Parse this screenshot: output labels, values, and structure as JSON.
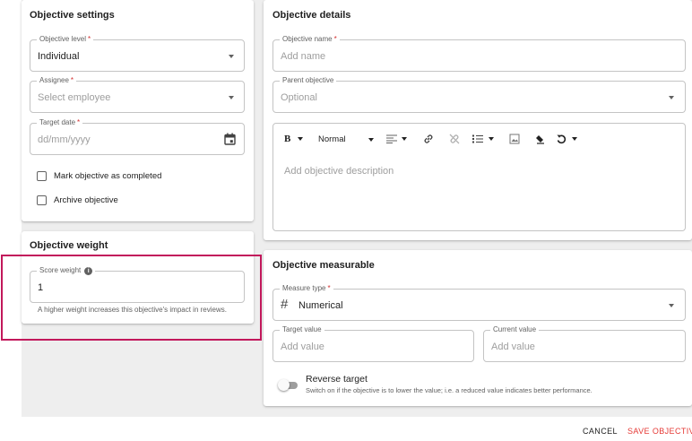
{
  "settings": {
    "title": "Objective settings",
    "level": {
      "label": "Objective level",
      "required_mark": "*",
      "value": "Individual"
    },
    "assignee": {
      "label": "Assignee",
      "required_mark": "*",
      "placeholder": "Select employee"
    },
    "target_date": {
      "label": "Target date",
      "required_mark": "*",
      "placeholder": "dd/mm/yyyy",
      "icon": "calendar-icon"
    },
    "mark_completed": {
      "label": "Mark objective as completed",
      "checked": false
    },
    "archive": {
      "label": "Archive objective",
      "checked": false
    }
  },
  "weight": {
    "title": "Objective weight",
    "score_label": "Score weight",
    "info_icon": "info-icon",
    "value": "1",
    "helper": "A higher weight increases this objective's impact in reviews."
  },
  "details": {
    "title": "Objective details",
    "name": {
      "label": "Objective name",
      "required_mark": "*",
      "placeholder": "Add name"
    },
    "parent": {
      "label": "Parent objective",
      "placeholder": "Optional"
    },
    "editor": {
      "bold": "B",
      "text_style": "Normal",
      "placeholder": "Add objective description",
      "icons": [
        "bold-icon",
        "align-icon",
        "link-icon",
        "unlink-icon",
        "list-icon",
        "image-icon",
        "clear-format-icon",
        "undo-icon"
      ]
    }
  },
  "measurable": {
    "title": "Objective measurable",
    "measure_type": {
      "label": "Measure type",
      "required_mark": "*",
      "symbol": "#",
      "value": "Numerical"
    },
    "target_value": {
      "label": "Target value",
      "placeholder": "Add value"
    },
    "current_value": {
      "label": "Current value",
      "placeholder": "Add value"
    },
    "reverse": {
      "label": "Reverse target",
      "description": "Switch on if the objective is to lower the value; i.e. a reduced value indicates better performance.",
      "on": false
    }
  },
  "footer": {
    "cancel": "CANCEL",
    "save": "SAVE OBJECTIVE"
  },
  "colors": {
    "accent": "#e53935",
    "required": "#d32f2f",
    "highlight": "#c2185b"
  }
}
